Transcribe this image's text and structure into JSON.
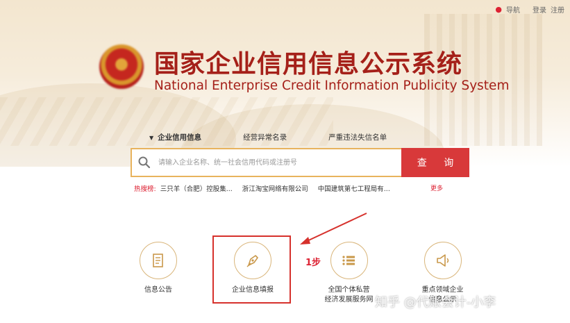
{
  "topbar": {
    "nav": "导航",
    "login": "登录",
    "register": "注册"
  },
  "title": {
    "cn": "国家企业信用信息公示系统",
    "en": "National Enterprise Credit Information Publicity System"
  },
  "tabs": [
    {
      "label": "企业信用信息",
      "active": true
    },
    {
      "label": "经营异常名录",
      "active": false
    },
    {
      "label": "严重违法失信名单",
      "active": false
    }
  ],
  "search": {
    "placeholder": "请输入企业名称、统一社会信用代码或注册号",
    "button": "查 询"
  },
  "hot": {
    "label": "热搜榜:",
    "items": [
      "三只羊（合肥）控股集...",
      "浙江淘宝网络有限公司",
      "中国建筑第七工程局有..."
    ],
    "more": "更多"
  },
  "features": [
    {
      "label": "信息公告",
      "icon": "document-icon"
    },
    {
      "label": "企业信息填报",
      "icon": "pen-nib-icon"
    },
    {
      "label": "全国个体私营\n经济发展服务网",
      "icon": "list-icon"
    },
    {
      "label": "重点领域企业\n信息公示",
      "icon": "megaphone-icon"
    }
  ],
  "annotation": {
    "step": "1步"
  },
  "watermark": "知乎 @代账会计-小李",
  "colors": {
    "brand_red": "#a52019",
    "button_red": "#d8393a",
    "gold": "#d9b57a"
  }
}
